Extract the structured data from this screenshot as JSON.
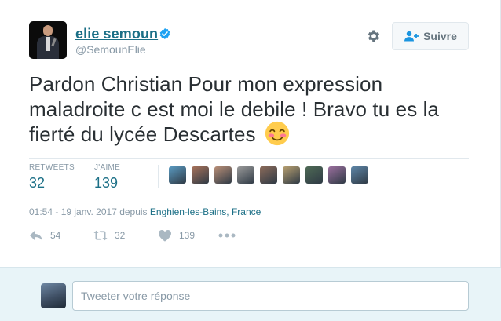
{
  "user": {
    "name": "elie semoun",
    "handle": "@SemounElie"
  },
  "follow_button": {
    "label": "Suivre"
  },
  "tweet": {
    "text": "Pardon Christian Pour mon expression maladroite c est moi le debile ! Bravo tu es la fierté du lycée Descartes"
  },
  "stats": {
    "retweets_label": "RETWEETS",
    "retweets": "32",
    "likes_label": "J'AIME",
    "likes": "139"
  },
  "likers": [
    {
      "color": "#5a9bc2"
    },
    {
      "color": "#a8725a"
    },
    {
      "color": "#b98f77"
    },
    {
      "color": "#9a9a9a"
    },
    {
      "color": "#8c6b5a"
    },
    {
      "color": "#b8a070"
    },
    {
      "color": "#4e6a55"
    },
    {
      "color": "#9b6f9e"
    },
    {
      "color": "#5e86a8"
    }
  ],
  "meta": {
    "time": "01:54 - 19 janv. 2017 depuis",
    "location": "Enghien-les-Bains, France"
  },
  "actions": {
    "reply_count": "54",
    "retweet_count": "32",
    "like_count": "139"
  },
  "reply": {
    "placeholder": "Tweeter votre réponse"
  },
  "colors": {
    "link": "#1b6f86",
    "muted": "#8899a6",
    "reply_bg": "#e8f4f8"
  }
}
